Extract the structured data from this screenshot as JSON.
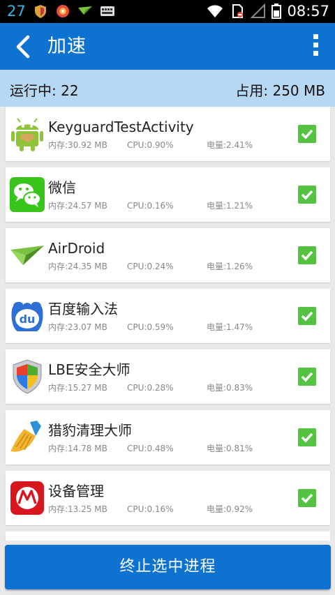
{
  "status_bar": {
    "notification_count": "27",
    "time": "08:57",
    "left_icons": [
      "shield-icon",
      "antivirus-icon",
      "airdroid-icon",
      "keyboard-icon"
    ],
    "right_icons": [
      "wifi-icon",
      "no-sim-icon",
      "signal-icon",
      "battery-icon"
    ]
  },
  "header": {
    "title": "加速",
    "back_icon": "chevron-left-icon",
    "menu_icon": "overflow-menu-icon"
  },
  "summary": {
    "running": "运行中: 22",
    "used": "占用: 250 MB"
  },
  "processes": [
    {
      "name": "KeyguardTestActivity",
      "memory": "内存:30.92 MB",
      "cpu": "CPU:0.90%",
      "battery": "电量:2.41%",
      "icon": "android-icon",
      "checked": true
    },
    {
      "name": "微信",
      "memory": "内存:24.57 MB",
      "cpu": "CPU:0.16%",
      "battery": "电量:1.21%",
      "icon": "wechat-icon",
      "checked": true
    },
    {
      "name": "AirDroid",
      "memory": "内存:24.35 MB",
      "cpu": "CPU:0.24%",
      "battery": "电量:1.26%",
      "icon": "airdroid-icon",
      "checked": true
    },
    {
      "name": "百度输入法",
      "memory": "内存:23.07 MB",
      "cpu": "CPU:0.59%",
      "battery": "电量:1.47%",
      "icon": "baidu-ime-icon",
      "checked": true
    },
    {
      "name": "LBE安全大师",
      "memory": "内存:15.27 MB",
      "cpu": "CPU:0.28%",
      "battery": "电量:0.83%",
      "icon": "lbe-shield-icon",
      "checked": true
    },
    {
      "name": "猎豹清理大师",
      "memory": "内存:14.78 MB",
      "cpu": "CPU:0.48%",
      "battery": "电量:0.81%",
      "icon": "broom-icon",
      "checked": true
    },
    {
      "name": "设备管理",
      "memory": "内存:13.25 MB",
      "cpu": "CPU:0.16%",
      "battery": "电量:0.92%",
      "icon": "motorola-icon",
      "checked": true
    }
  ],
  "actions": {
    "kill_label": "终止选中进程"
  },
  "colors": {
    "accent": "#0e72d1",
    "summary_bg": "#b7d8f3",
    "check_green": "#55c244",
    "status_blue": "#33b5e5"
  }
}
